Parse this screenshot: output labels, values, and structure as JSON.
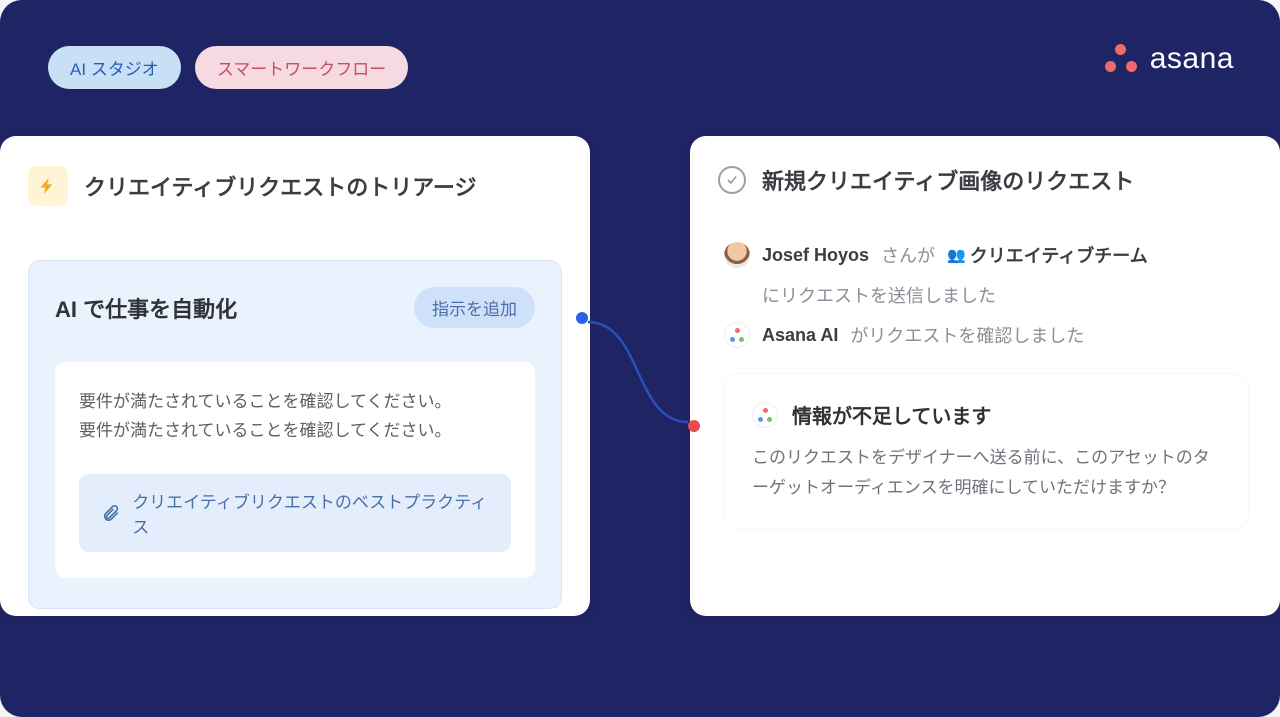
{
  "pills": {
    "ai_studio": "AI スタジオ",
    "smart_workflow": "スマートワークフロー"
  },
  "brand": "asana",
  "left_panel": {
    "title": "クリエイティブリクエストのトリアージ",
    "ai_card": {
      "title": "AI で仕事を自動化",
      "add_instruction": "指示を追加",
      "requirement_line1": "要件が満たされていることを確認してください。",
      "requirement_line2": "要件が満たされていることを確認してください。",
      "attachment": "クリエイティブリクエストのベストプラクティス"
    }
  },
  "right_panel": {
    "title": "新規クリエイティブ画像のリクエスト",
    "activity": {
      "user": "Josef Hoyos",
      "user_suffix": "さんが",
      "team": "クリエイティブチーム",
      "sent_text": "にリクエストを送信しました",
      "asana_ai": "Asana AI",
      "confirmed": "がリクエストを確認しました"
    },
    "ai_response": {
      "title": "情報が不足しています",
      "body": "このリクエストをデザイナーへ送る前に、このアセットのターゲットオーディエンスを明確にしていただけますか？"
    }
  }
}
